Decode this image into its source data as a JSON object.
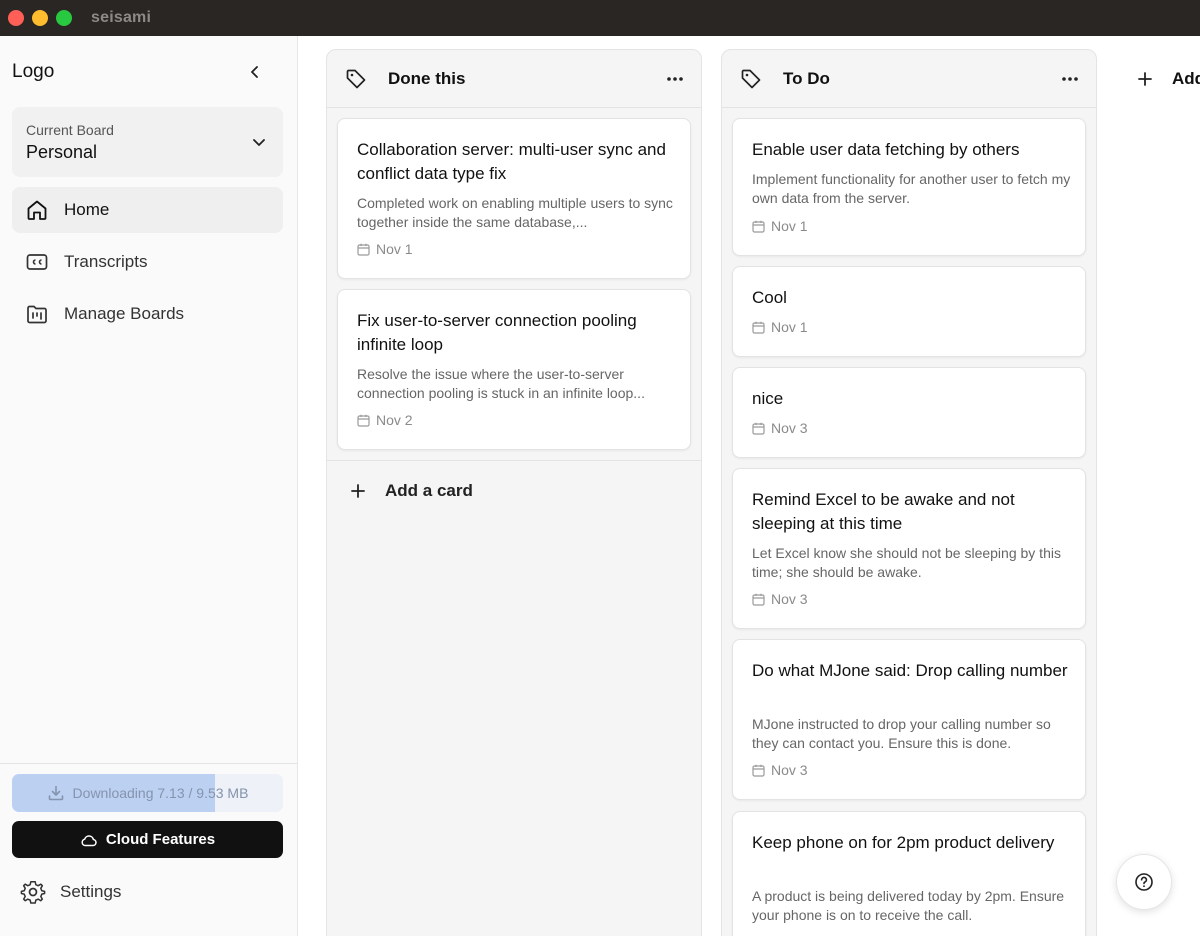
{
  "window": {
    "title": "seisami"
  },
  "sidebar": {
    "logo": "Logo",
    "board_selector": {
      "caption": "Current Board",
      "value": "Personal"
    },
    "nav": [
      {
        "label": "Home",
        "icon": "home-icon",
        "active": true
      },
      {
        "label": "Transcripts",
        "icon": "closed-caption-icon",
        "active": false
      },
      {
        "label": "Manage Boards",
        "icon": "folder-kanban-icon",
        "active": false
      }
    ],
    "download": {
      "text": "Downloading 7.13 / 9.53 MB",
      "progress_fraction": 0.748
    },
    "cloud_button": "Cloud Features",
    "settings_label": "Settings"
  },
  "board": {
    "columns": [
      {
        "title": "Done this",
        "cards": [
          {
            "title": "Collaboration server: multi-user sync and conflict data type fix",
            "description": "Completed work on enabling multiple users to sync together inside the same database,...",
            "date": "Nov 1"
          },
          {
            "title": "Fix user-to-server connection pooling infinite loop",
            "description": "Resolve the issue where the user-to-server connection pooling is stuck in an infinite loop...",
            "date": "Nov 2"
          }
        ],
        "add_card_label": "Add a card"
      },
      {
        "title": "To Do",
        "cards": [
          {
            "title": "Enable user data fetching by others",
            "description": "Implement functionality for another user to fetch my own data from the server.",
            "date": "Nov 1"
          },
          {
            "title": "Cool",
            "description": "",
            "date": "Nov 1"
          },
          {
            "title": "nice",
            "description": "",
            "date": "Nov 3"
          },
          {
            "title": "Remind Excel to be awake and not sleeping at this time",
            "description": "Let Excel know she should not be sleeping by this time; she should be awake.",
            "date": "Nov 3"
          },
          {
            "title": "Do what MJone said: Drop calling number",
            "description": "MJone instructed to drop your calling number so they can contact you. Ensure this is done.",
            "date": "Nov 3"
          },
          {
            "title": "Keep phone on for 2pm product delivery",
            "description": "A product is being delivered today by 2pm. Ensure your phone is on to receive the call.",
            "date": ""
          }
        ]
      }
    ],
    "add_list_label": "Add"
  },
  "colors": {
    "titlebar": "#2a2624",
    "sidebar_bg": "#fafafa",
    "column_bg": "#f5f5f5",
    "cloud_button_bg": "#111111",
    "download_fill": "#bcd0f2"
  }
}
